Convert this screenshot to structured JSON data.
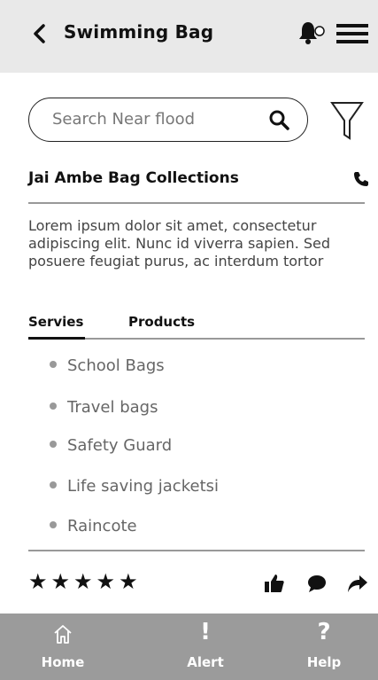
{
  "header": {
    "title": "Swimming Bag"
  },
  "search": {
    "placeholder": "Search Near flood"
  },
  "shop": {
    "name": "Jai Ambe Bag Collections",
    "description": "Lorem ipsum dolor sit amet, consectetur adipiscing elit. Nunc id viverra sapien. Sed posuere feugiat purus, ac interdum tortor"
  },
  "tabs": [
    {
      "label": "Servies",
      "active": true
    },
    {
      "label": "Products",
      "active": false
    }
  ],
  "services": [
    "School Bags",
    "Travel bags",
    "Safety Guard",
    "Life saving jacketsi",
    "Raincote"
  ],
  "rating": {
    "stars": "★★★★★"
  },
  "bottom_nav": {
    "items": [
      {
        "label": "Home",
        "icon": "home-icon"
      },
      {
        "label": "Alert",
        "icon": "alert-icon",
        "glyph": "!"
      },
      {
        "label": "Help",
        "icon": "help-icon",
        "glyph": "?"
      }
    ]
  }
}
